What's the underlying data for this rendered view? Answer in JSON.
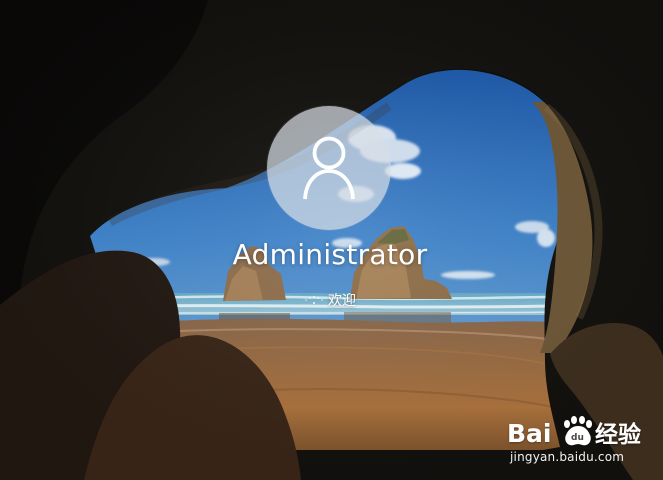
{
  "login_screen": {
    "username": "Administrator",
    "status_text": "欢迎",
    "avatar_icon": "user-icon"
  },
  "watermark": {
    "logo_text": "Baidu经验",
    "url": "jingyan.baidu.com"
  },
  "colors": {
    "text": "#ffffff",
    "avatar_background": "#d7dee4",
    "sky": "#2f6fb8",
    "sand": "#9c6a3c",
    "cave": "#1d150f"
  }
}
